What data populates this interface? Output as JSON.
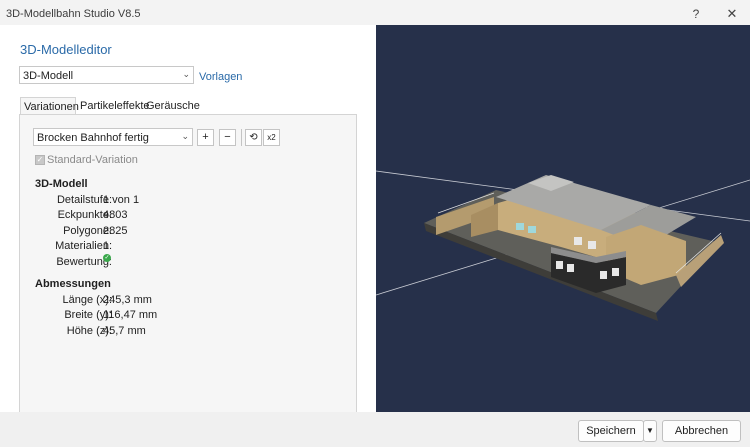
{
  "window": {
    "title": "3D-Modellbahn Studio V8.5",
    "help": "?",
    "close": "✕"
  },
  "editor": {
    "heading": "3D-Modelleditor",
    "model_select": "3D-Modell",
    "templates_link": "Vorlagen",
    "tabs": [
      {
        "label": "Variationen"
      },
      {
        "label": "Partikeleffekte"
      },
      {
        "label": "Geräusche"
      }
    ],
    "variation_select": "Brocken Bahnhof fertig",
    "buttons": {
      "add": "+",
      "remove": "−",
      "refresh": "⟲",
      "x2": "x2"
    },
    "standard_variation": "Standard-Variation"
  },
  "model": {
    "section": "3D-Modell",
    "rows": [
      {
        "label": "Detailstufe:",
        "value": "1 von 1"
      },
      {
        "label": "Eckpunkte:",
        "value": "4803"
      },
      {
        "label": "Polygone:",
        "value": "2825"
      },
      {
        "label": "Materialien:",
        "value": "1"
      },
      {
        "label": "Bewertung:",
        "value": ""
      }
    ]
  },
  "dimensions": {
    "section": "Abmessungen",
    "rows": [
      {
        "label": "Länge (x):",
        "value": "245,3 mm"
      },
      {
        "label": "Breite (y):",
        "value": "116,47 mm"
      },
      {
        "label": "Höhe (z):",
        "value": "45,7 mm"
      }
    ]
  },
  "footer": {
    "save": "Speichern",
    "cancel": "Abbrechen"
  },
  "colors": {
    "accent": "#2a6aa8",
    "viewport_bg": "#26304a",
    "ok": "#3aa84b"
  }
}
